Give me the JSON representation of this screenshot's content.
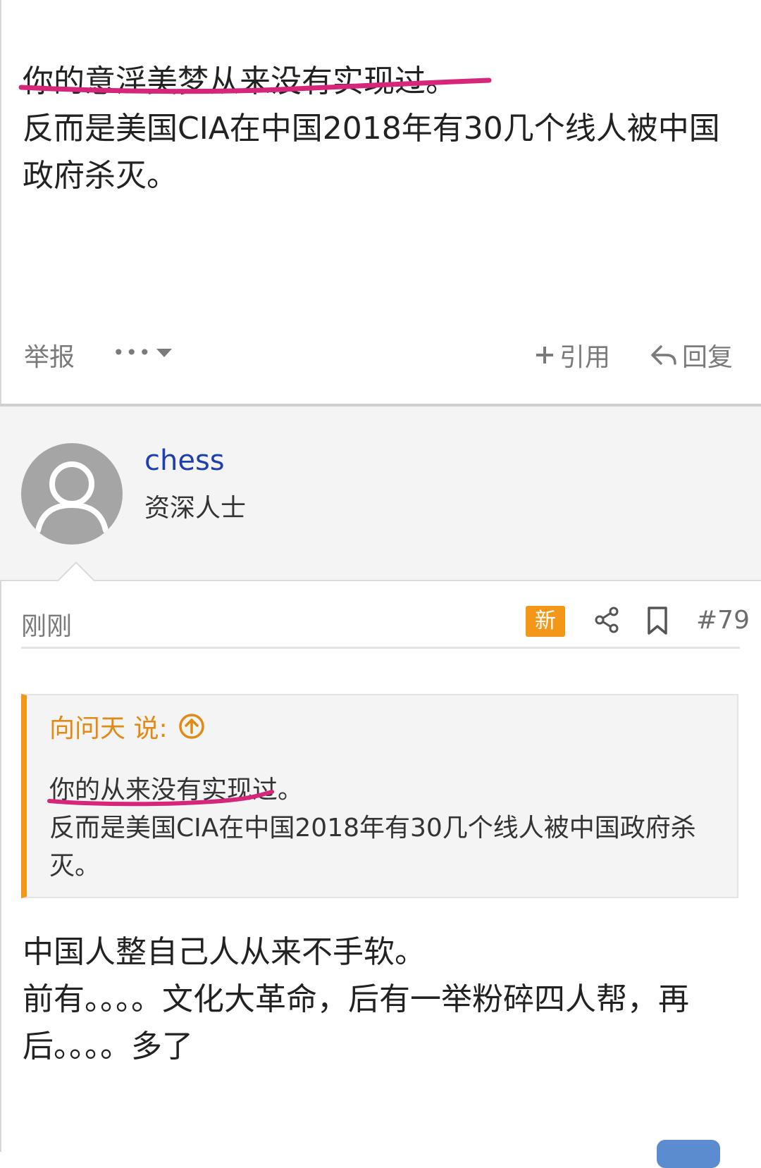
{
  "post1": {
    "line1": "你的意淫美梦从来没有实现过。",
    "line2": "反而是美国CIA在中国2018年有30几个线人被中国政府杀灭。",
    "actions": {
      "report": "举报",
      "more": "•••",
      "quote": "引用",
      "reply": "回复"
    }
  },
  "user": {
    "name": "chess",
    "title": "资深人士"
  },
  "post2": {
    "time": "刚刚",
    "badge": "新",
    "number": "#79",
    "quote": {
      "author_said": "向问天 说:",
      "line1": "你的从来没有实现过。",
      "line2": "反而是美国CIA在中国2018年有30几个线人被中国政府杀灭。"
    },
    "body_lines": [
      "中国人整自己人从来不手软。",
      "前有。。。。文化大革命，后有一举粉碎四人帮，再后。。。。多了"
    ]
  },
  "colors": {
    "accent_orange": "#f29718",
    "username_blue": "#1f3fb0",
    "annotation_pink": "#d6267a"
  }
}
